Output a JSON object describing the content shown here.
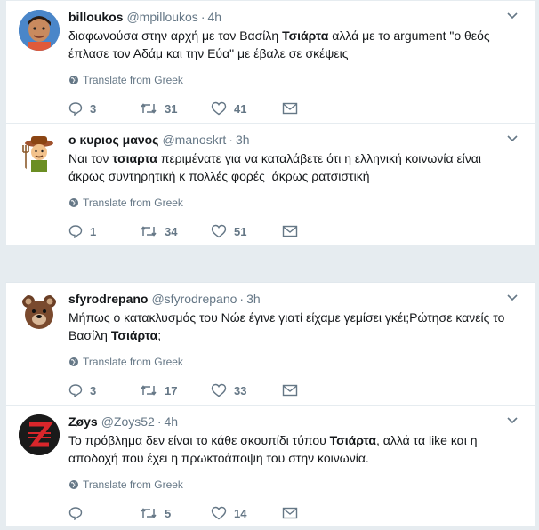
{
  "thread1": {
    "tweets": [
      {
        "name": "billoukos",
        "handle": "@mpilloukos",
        "time": "4h",
        "text_parts": [
          "διαφωνούσα στην αρχή με τον Βασίλη ",
          "Τσιάρτα",
          " αλλά με το argument \"ο θεός έπλασε τον Αδάμ και την Εύα\" με έβαλε σε σκέψεις"
        ],
        "translate": "Translate from Greek",
        "replies": "3",
        "retweets": "31",
        "likes": "41",
        "avatar_color": "#3a6fb0"
      },
      {
        "name": "ο κυριος μανος",
        "handle": "@manoskrt",
        "time": "3h",
        "text_parts": [
          "Ναι τον ",
          "τσιαρτα",
          " περιμένατε για να καταλάβετε ότι η ελληνική κοινωνία είναι άκρως συντηρητική κ πολλές φορές  άκρως ρατσιστική"
        ],
        "translate": "Translate from Greek",
        "replies": "1",
        "retweets": "34",
        "likes": "51",
        "avatar_color": "#ffffff"
      }
    ]
  },
  "thread2": {
    "tweets": [
      {
        "name": "sfyrodrepano",
        "handle": "@sfyrodrepano",
        "time": "3h",
        "text_parts": [
          "Μήπως ο κατακλυσμός του Νώε έγινε γιατί είχαμε γεμίσει γκέι;Ρώτησε κανείς το Βασίλη ",
          "Τσιάρτα",
          ";"
        ],
        "translate": "Translate from Greek",
        "replies": "3",
        "retweets": "17",
        "likes": "33",
        "avatar_color": "#ffffff"
      },
      {
        "name": "Zøys",
        "handle": "@Zoys52",
        "time": "4h",
        "text_parts": [
          "Το πρόβλημα δεν είναι το κάθε σκουπίδι τύπου ",
          "Τσιάρτα",
          ", αλλά τα like και η αποδοχή που έχει η πρωκτοάποψη του στην κοινωνία."
        ],
        "translate": "Translate from Greek",
        "replies": "",
        "retweets": "5",
        "likes": "14",
        "avatar_color": "#1a1a1a"
      }
    ]
  },
  "colors": {
    "text": "#14171a",
    "secondary": "#657786",
    "background": "#e6ecf0",
    "zoys_red": "#d9262b"
  }
}
